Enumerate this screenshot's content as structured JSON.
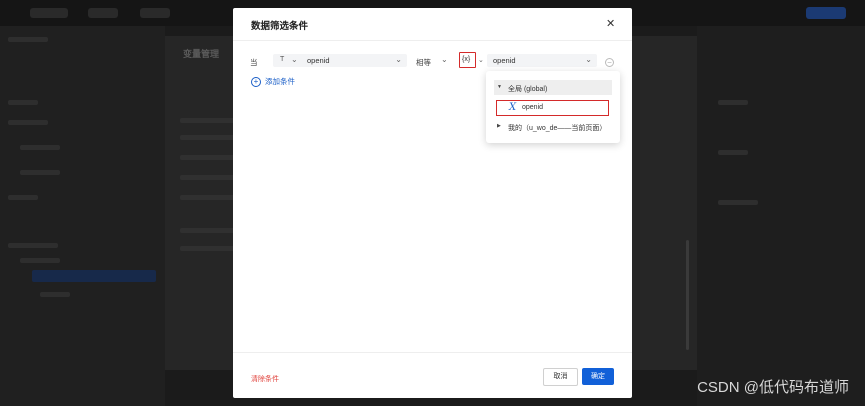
{
  "modal": {
    "title": "数据筛选条件",
    "close_icon": "close-icon"
  },
  "condition": {
    "prefix": "当",
    "field_type_icon": "T",
    "field_value": "openid",
    "operator": "相等",
    "variable_toggle": "{x}",
    "value_select": "openid"
  },
  "add_condition_label": "添加条件",
  "dropdown": {
    "global_label": "全局 (global)",
    "openid_label": "openid",
    "mine_label": "我的（u_wo_de——当前页面）"
  },
  "footer": {
    "clear_label": "清除条件",
    "cancel_label": "取消",
    "ok_label": "确定"
  },
  "background": {
    "panel_title": "变量管理"
  },
  "watermark": "CSDN @低代码布道师",
  "colors": {
    "primary": "#1160d8",
    "danger": "#e0403a",
    "highlight_border": "#d42a2a"
  }
}
